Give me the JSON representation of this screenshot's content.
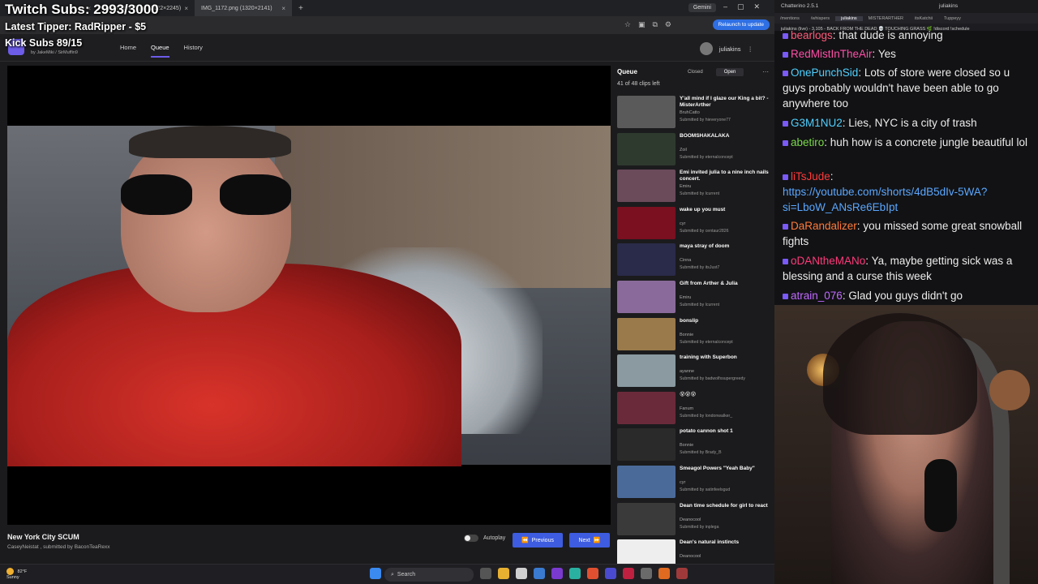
{
  "overlay": {
    "twitch_subs": "Twitch Subs: 2993/3000",
    "latest_tipper": "Latest Tipper: RadRipper - $5",
    "kick_subs": "Kick Subs 89/15"
  },
  "browser": {
    "tabs": [
      {
        "label": ""
      },
      {
        "label": "Prison_Break.jpg (1622×2245)"
      },
      {
        "label": "IMG_1172.png (1320×2141)"
      }
    ],
    "gemini": "Gemini",
    "relaunch": "Relaunch to update"
  },
  "site": {
    "breadcrumb": "by JakeMiki / SirMuffin9",
    "nav": [
      "Home",
      "Queue",
      "History"
    ],
    "user": "juliakins"
  },
  "player": {
    "title": "New York City SCUM",
    "subtitle": "CaseyNeistat , submitted by BaconTeaRexx",
    "autoplay": "Autoplay",
    "previous": "Previous",
    "next": "Next"
  },
  "queue": {
    "heading": "Queue",
    "count": "41 of 48 clips left",
    "closed": "Closed",
    "open": "Open",
    "clips": [
      {
        "title": "Y'all mind if I glaze our King a bit? - MisterArther",
        "author": "BruhCatto",
        "submitted": "Submitted by hieveryone77",
        "color": "#5a5a5a"
      },
      {
        "title": "BOOMSHAKALAKA",
        "author": "Zoil",
        "submitted": "Submitted by eternalconcept",
        "color": "#2f3a2e"
      },
      {
        "title": "Emi invited julia to a nine inch nails concert.",
        "author": "Emiru",
        "submitted": "Submitted by lcurrent",
        "color": "#6b4a5a"
      },
      {
        "title": "wake up you must",
        "author": "cyr",
        "submitted": "Submitted by centaur2826",
        "color": "#7a1020"
      },
      {
        "title": "maya stray of doom",
        "author": "Cinna",
        "submitted": "Submitted by itsJust7",
        "color": "#2a2a4a"
      },
      {
        "title": "Gift from Arther & Julia",
        "author": "Emiru",
        "submitted": "Submitted by lcurrent",
        "color": "#8a6a9a"
      },
      {
        "title": "bonslip",
        "author": "Bonnie",
        "submitted": "Submitted by eternalconcept",
        "color": "#9a7a4a"
      },
      {
        "title": "training with Superbon",
        "author": "ayanne",
        "submitted": "Submitted by badwolfxsupergreedy",
        "color": "#8a9aa0"
      },
      {
        "title": "😵😵😵",
        "author": "Fanum",
        "submitted": "Submitted by londonwalker_",
        "color": "#6a2a3a"
      },
      {
        "title": "potato cannon shot 1",
        "author": "Bonnie",
        "submitted": "Submitted by Brady_B",
        "color": "#2a2a2a"
      },
      {
        "title": "Smeagol Powers \"Yeah Baby\"",
        "author": "cyr",
        "submitted": "Submitted by satinfeelsgud",
        "color": "#4a6a9a"
      },
      {
        "title": "Dean time schedule for girl to react",
        "author": "Deanocool",
        "submitted": "Submitted by inplega",
        "color": "#3a3a3a"
      },
      {
        "title": "Dean's natural instincts",
        "author": "Deanocool",
        "submitted": "",
        "color": "#eeeeee"
      }
    ]
  },
  "taskbar": {
    "temp": "82°F",
    "weather": "Sunny",
    "search": "Search"
  },
  "chat": {
    "app_title": "Chatterino 2.5.1",
    "window_user": "juliakins",
    "tabs": [
      "/mentions",
      "/whispers",
      "juliakins",
      "MISTERARTHER",
      "itsKatchii",
      "Tuppeyy"
    ],
    "info": "juliakins (live) - 3,105 - BACK FROM THE DEAD 💀 TOUCHING GRASS 🌿 !discord !schedule",
    "messages": [
      {
        "user": "bearlogs",
        "text": "that dude is annoying",
        "color": "#ff5a7a"
      },
      {
        "user": "RedMistInTheAir",
        "text": "Yes",
        "color": "#ff4fa8"
      },
      {
        "user": "OnePunchSid",
        "text": "Lots of store were closed so u guys probably wouldn't have been able to go anywhere too",
        "color": "#4fd0ff"
      },
      {
        "user": "G3M1NU2",
        "text": "Lies, NYC is a city of trash",
        "color": "#4fd0ff"
      },
      {
        "user": "abetiro",
        "text": "huh how is a concrete jungle beautiful lol",
        "color": "#7ad94a"
      },
      {
        "user": "liTsJude",
        "text": "",
        "color": "#ff3a3a"
      },
      {
        "user": "",
        "text": "https://youtube.com/shorts/4dB5dIv-5WA?si=LboW_ANsRe6EbIpt",
        "color": "#5aa7ff"
      },
      {
        "user": "DaRandalizer",
        "text": "you missed some great snowball fights",
        "color": "#ff7a3a"
      },
      {
        "user": "oDANtheMANo",
        "text": "Ya, maybe getting sick was a blessing and a curse this week",
        "color": "#ff3a7a"
      },
      {
        "user": "atrain_076",
        "text": "Glad you guys didn't go",
        "color": "#c06aff"
      }
    ]
  }
}
